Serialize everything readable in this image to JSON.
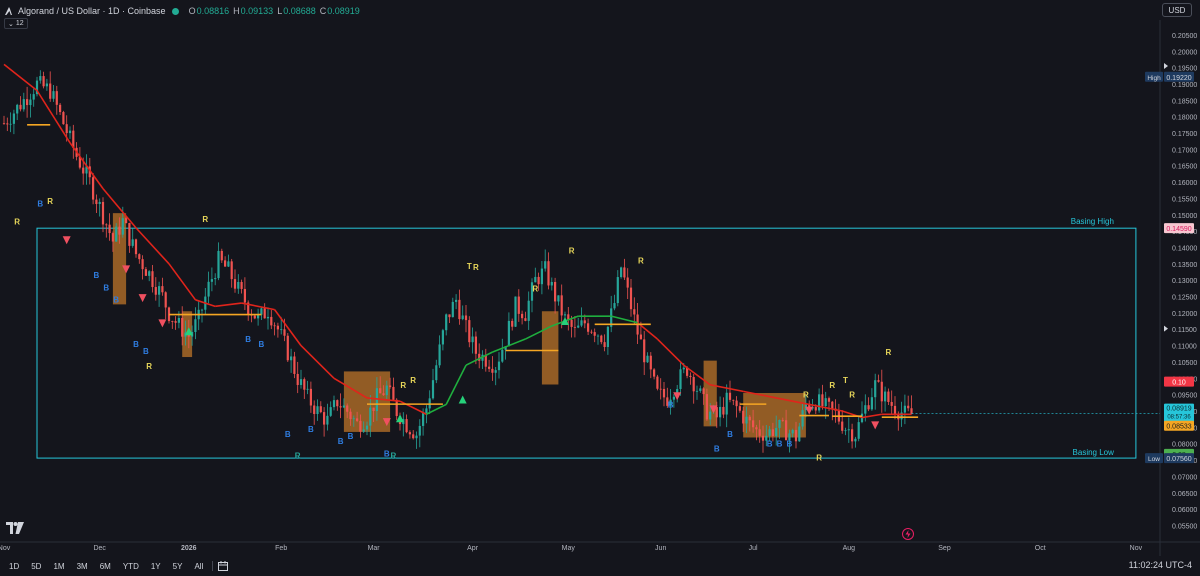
{
  "header": {
    "symbol": "Algorand / US Dollar · 1D · Coinbase",
    "ohlc": [
      {
        "key": "O",
        "value": "0.08816"
      },
      {
        "key": "H",
        "value": "0.09133"
      },
      {
        "key": "L",
        "value": "0.08688"
      },
      {
        "key": "C",
        "value": "0.08919"
      }
    ],
    "indicator_toggle": "12",
    "currency": "USD"
  },
  "colors": {
    "background": "#14151c",
    "up": "#26a69a",
    "down": "#ef5350",
    "trail_red": "#e0241b",
    "trail_green": "#1fae3e",
    "basing_box": "#26c6da",
    "orange": "#f5a623",
    "cloud": "#c87a2a",
    "label_b": "#2f7de1",
    "label_r": "#e8d75a"
  },
  "axis": {
    "price_ticks": [
      "0.20500",
      "0.20000",
      "0.19500",
      "0.19000",
      "0.18500",
      "0.18000",
      "0.17500",
      "0.17000",
      "0.16500",
      "0.16000",
      "0.15500",
      "0.15000",
      "0.14500",
      "0.14000",
      "0.13500",
      "0.13000",
      "0.12500",
      "0.12000",
      "0.11500",
      "0.11000",
      "0.10500",
      "0.10000",
      "0.09500",
      "0.09000",
      "0.08500",
      "0.08000",
      "0.07500",
      "0.07000",
      "0.06500",
      "0.06000",
      "0.05500"
    ],
    "time_ticks": [
      "Nov",
      "Dec",
      "2026",
      "Feb",
      "Mar",
      "Apr",
      "May",
      "Jun",
      "Jul",
      "Aug",
      "Sep",
      "Oct",
      "Nov"
    ],
    "high_label": "High",
    "high_value": "0.19220",
    "low_label": "Low",
    "low_value": "0.07560",
    "basing_high_value": "0.14590",
    "last_price": "0.08919",
    "countdown": "08:57:36",
    "prev_price_tag": "0.08533",
    "red_tag": "0.10",
    "green_tag": "0.08"
  },
  "annotations": {
    "basing_high": "Basing High",
    "basing_low": "Basing Low"
  },
  "bottom": {
    "ranges": [
      "1D",
      "5D",
      "1M",
      "3M",
      "6M",
      "YTD",
      "1Y",
      "5Y",
      "All"
    ],
    "clock": "11:02:24 UTC-4"
  },
  "chart_data": {
    "type": "candlestick",
    "ylim": [
      0.053,
      0.2065
    ],
    "basing_high": 0.1459,
    "basing_low": 0.0756,
    "session_high": 0.1922,
    "session_low": 0.0756,
    "last": 0.08919,
    "trend_samples": [
      [
        0,
        0.178
      ],
      [
        6,
        0.185
      ],
      [
        10,
        0.19
      ],
      [
        14,
        0.188
      ],
      [
        18,
        0.178
      ],
      [
        22,
        0.168
      ],
      [
        26,
        0.16
      ],
      [
        30,
        0.15
      ],
      [
        33,
        0.142
      ],
      [
        36,
        0.148
      ],
      [
        40,
        0.138
      ],
      [
        44,
        0.132
      ],
      [
        48,
        0.125
      ],
      [
        50,
        0.12
      ],
      [
        53,
        0.116
      ],
      [
        56,
        0.113
      ],
      [
        59,
        0.118
      ],
      [
        62,
        0.128
      ],
      [
        65,
        0.136
      ],
      [
        68,
        0.133
      ],
      [
        71,
        0.127
      ],
      [
        74,
        0.122
      ],
      [
        77,
        0.118
      ],
      [
        80,
        0.121
      ],
      [
        83,
        0.115
      ],
      [
        86,
        0.108
      ],
      [
        89,
        0.1
      ],
      [
        92,
        0.094
      ],
      [
        95,
        0.09
      ],
      [
        98,
        0.087
      ],
      [
        101,
        0.093
      ],
      [
        104,
        0.09
      ],
      [
        107,
        0.086
      ],
      [
        110,
        0.088
      ],
      [
        113,
        0.094
      ],
      [
        116,
        0.097
      ],
      [
        119,
        0.09
      ],
      [
        122,
        0.086
      ],
      [
        125,
        0.083
      ],
      [
        128,
        0.091
      ],
      [
        131,
        0.104
      ],
      [
        134,
        0.118
      ],
      [
        137,
        0.124
      ],
      [
        140,
        0.115
      ],
      [
        143,
        0.108
      ],
      [
        146,
        0.106
      ],
      [
        149,
        0.104
      ],
      [
        152,
        0.112
      ],
      [
        155,
        0.122
      ],
      [
        158,
        0.12
      ],
      [
        161,
        0.13
      ],
      [
        164,
        0.133
      ],
      [
        167,
        0.125
      ],
      [
        170,
        0.118
      ],
      [
        173,
        0.114
      ],
      [
        176,
        0.117
      ],
      [
        179,
        0.115
      ],
      [
        182,
        0.112
      ],
      [
        185,
        0.123
      ],
      [
        187,
        0.134
      ],
      [
        189,
        0.126
      ],
      [
        192,
        0.114
      ],
      [
        195,
        0.104
      ],
      [
        198,
        0.095
      ],
      [
        201,
        0.094
      ],
      [
        204,
        0.099
      ],
      [
        207,
        0.103
      ],
      [
        210,
        0.097
      ],
      [
        213,
        0.09
      ],
      [
        216,
        0.088
      ],
      [
        219,
        0.093
      ],
      [
        222,
        0.091
      ],
      [
        225,
        0.087
      ],
      [
        228,
        0.084
      ],
      [
        231,
        0.083
      ],
      [
        234,
        0.085
      ],
      [
        237,
        0.084
      ],
      [
        240,
        0.082
      ],
      [
        243,
        0.092
      ],
      [
        246,
        0.093
      ],
      [
        249,
        0.091
      ],
      [
        252,
        0.089
      ],
      [
        255,
        0.085
      ],
      [
        258,
        0.083
      ],
      [
        261,
        0.091
      ],
      [
        264,
        0.098
      ],
      [
        267,
        0.094
      ],
      [
        270,
        0.091
      ],
      [
        273,
        0.089
      ],
      [
        275,
        0.089
      ]
    ],
    "trail_stop_samples": [
      [
        0,
        0.196
      ],
      [
        10,
        0.188
      ],
      [
        20,
        0.172
      ],
      [
        30,
        0.158
      ],
      [
        40,
        0.146
      ],
      [
        50,
        0.135
      ],
      [
        58,
        0.124
      ],
      [
        64,
        0.122
      ],
      [
        72,
        0.123
      ],
      [
        82,
        0.121
      ],
      [
        90,
        0.11
      ],
      [
        100,
        0.1
      ],
      [
        110,
        0.094
      ],
      [
        120,
        0.093
      ],
      [
        128,
        0.089
      ],
      [
        134,
        0.092
      ],
      [
        140,
        0.104
      ],
      [
        148,
        0.108
      ],
      [
        158,
        0.112
      ],
      [
        166,
        0.116
      ],
      [
        174,
        0.119
      ],
      [
        184,
        0.119
      ],
      [
        192,
        0.117
      ],
      [
        198,
        0.112
      ],
      [
        206,
        0.104
      ],
      [
        214,
        0.098
      ],
      [
        224,
        0.096
      ],
      [
        234,
        0.094
      ],
      [
        244,
        0.092
      ],
      [
        254,
        0.09
      ],
      [
        260,
        0.088
      ],
      [
        266,
        0.089
      ],
      [
        275,
        0.089
      ]
    ],
    "events": [
      {
        "label": "R",
        "x": 4,
        "price": 0.1471
      },
      {
        "label": "B",
        "x": 11,
        "price": 0.1526
      },
      {
        "label": "R",
        "x": 14,
        "price": 0.1533
      },
      {
        "label": "B",
        "x": 28,
        "price": 0.1306
      },
      {
        "label": "B",
        "x": 31,
        "price": 0.1269
      },
      {
        "label": "B",
        "x": 34,
        "price": 0.1231
      },
      {
        "label": "B",
        "x": 40,
        "price": 0.1096
      },
      {
        "label": "B",
        "x": 43,
        "price": 0.1074
      },
      {
        "label": "R",
        "x": 44,
        "price": 0.1029
      },
      {
        "label": "R",
        "x": 61,
        "price": 0.1478
      },
      {
        "label": "B",
        "x": 74,
        "price": 0.1111
      },
      {
        "label": "B",
        "x": 78,
        "price": 0.1096
      },
      {
        "label": "B",
        "x": 86,
        "price": 0.0821
      },
      {
        "label": "B",
        "x": 93,
        "price": 0.0836
      },
      {
        "label": "B",
        "x": 102,
        "price": 0.0799
      },
      {
        "label": "B",
        "x": 105,
        "price": 0.0814
      },
      {
        "label": "R",
        "x": 89,
        "price": 0.0754
      },
      {
        "label": "R",
        "x": 118,
        "price": 0.0754
      },
      {
        "label": "B",
        "x": 116,
        "price": 0.0761
      },
      {
        "label": "R",
        "x": 121,
        "price": 0.0971
      },
      {
        "label": "R",
        "x": 124,
        "price": 0.0986
      },
      {
        "label": "T",
        "x": 141,
        "price": 0.1334
      },
      {
        "label": "R",
        "x": 143,
        "price": 0.1331
      },
      {
        "label": "R",
        "x": 161,
        "price": 0.1266
      },
      {
        "label": "R",
        "x": 172,
        "price": 0.1381
      },
      {
        "label": "R",
        "x": 193,
        "price": 0.1351
      },
      {
        "label": "B",
        "x": 202,
        "price": 0.0911
      },
      {
        "label": "B",
        "x": 216,
        "price": 0.0776
      },
      {
        "label": "B",
        "x": 220,
        "price": 0.0821
      },
      {
        "label": "B",
        "x": 232,
        "price": 0.0791
      },
      {
        "label": "B",
        "x": 235,
        "price": 0.0791
      },
      {
        "label": "B",
        "x": 238,
        "price": 0.0791
      },
      {
        "label": "R",
        "x": 243,
        "price": 0.0941
      },
      {
        "label": "R",
        "x": 247,
        "price": 0.0749
      },
      {
        "label": "R",
        "x": 251,
        "price": 0.0971
      },
      {
        "label": "T",
        "x": 255,
        "price": 0.0986
      },
      {
        "label": "R",
        "x": 257,
        "price": 0.0941
      },
      {
        "label": "R",
        "x": 268,
        "price": 0.1071
      }
    ],
    "signals": [
      {
        "dir": "down",
        "x": 19,
        "price": 0.1422
      },
      {
        "dir": "down",
        "x": 37,
        "price": 0.1333
      },
      {
        "dir": "down",
        "x": 42,
        "price": 0.1245
      },
      {
        "dir": "down",
        "x": 48,
        "price": 0.1168
      },
      {
        "dir": "up",
        "x": 56,
        "price": 0.1144
      },
      {
        "dir": "down",
        "x": 116,
        "price": 0.0866
      },
      {
        "dir": "up",
        "x": 120,
        "price": 0.0878
      },
      {
        "dir": "up",
        "x": 139,
        "price": 0.0935
      },
      {
        "dir": "up",
        "x": 170,
        "price": 0.1175
      },
      {
        "dir": "down",
        "x": 204,
        "price": 0.0945
      },
      {
        "dir": "down",
        "x": 215,
        "price": 0.0905
      },
      {
        "dir": "down",
        "x": 244,
        "price": 0.0901
      },
      {
        "dir": "down",
        "x": 264,
        "price": 0.0856
      }
    ],
    "orange_lines": [
      {
        "x0": 7,
        "x1": 14,
        "price": 0.1775
      },
      {
        "x0": 50,
        "x1": 78,
        "price": 0.1195
      },
      {
        "x0": 110,
        "x1": 133,
        "price": 0.0921
      },
      {
        "x0": 152,
        "x1": 168,
        "price": 0.1085
      },
      {
        "x0": 179,
        "x1": 196,
        "price": 0.1165
      },
      {
        "x0": 223,
        "x1": 231,
        "price": 0.0921
      },
      {
        "x0": 241,
        "x1": 250,
        "price": 0.0886
      },
      {
        "x0": 251,
        "x1": 260,
        "price": 0.0884
      },
      {
        "x0": 266,
        "x1": 277,
        "price": 0.0881
      }
    ],
    "clouds": [
      {
        "x0": 33,
        "x1": 37,
        "top": 0.1505,
        "bottom": 0.1226
      },
      {
        "x0": 54,
        "x1": 57,
        "top": 0.1205,
        "bottom": 0.1065
      },
      {
        "x0": 103,
        "x1": 117,
        "top": 0.1021,
        "bottom": 0.0836
      },
      {
        "x0": 163,
        "x1": 168,
        "top": 0.1205,
        "bottom": 0.0981
      },
      {
        "x0": 212,
        "x1": 216,
        "top": 0.1054,
        "bottom": 0.0853
      },
      {
        "x0": 224,
        "x1": 243,
        "top": 0.0955,
        "bottom": 0.0819
      }
    ]
  }
}
